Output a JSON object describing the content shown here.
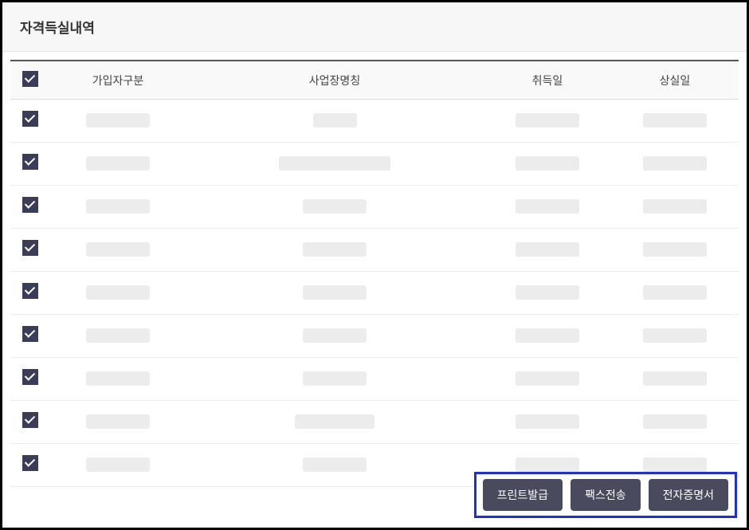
{
  "panel": {
    "title": "자격득실내역"
  },
  "table": {
    "headers": {
      "type": "가입자구분",
      "name": "사업장명칭",
      "acquired": "취득일",
      "lost": "상실일"
    },
    "rows": [
      {
        "checked": true
      },
      {
        "checked": true
      },
      {
        "checked": true
      },
      {
        "checked": true
      },
      {
        "checked": true
      },
      {
        "checked": true
      },
      {
        "checked": true
      },
      {
        "checked": true
      },
      {
        "checked": true
      }
    ]
  },
  "actions": {
    "print": "프린트발급",
    "fax": "팩스전송",
    "ecert": "전자증명서"
  }
}
